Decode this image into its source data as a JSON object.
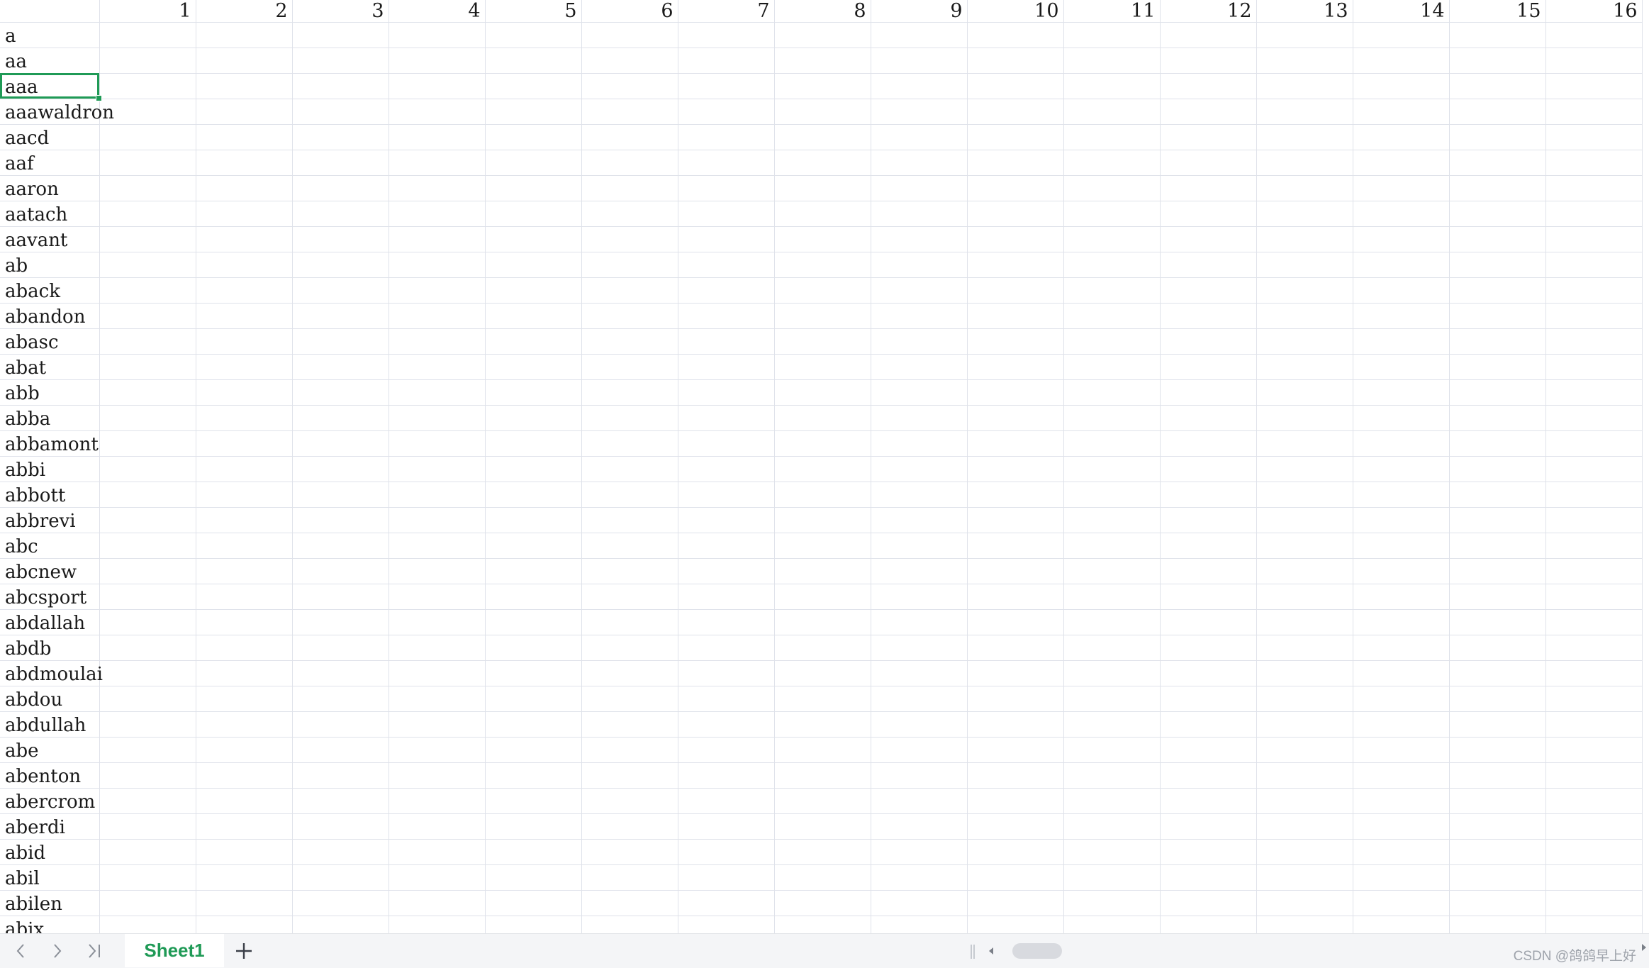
{
  "columns": [
    "1",
    "2",
    "3",
    "4",
    "5",
    "6",
    "7",
    "8",
    "9",
    "10",
    "11",
    "12",
    "13",
    "14",
    "15",
    "16"
  ],
  "rows": [
    "a",
    "aa",
    "aaa",
    "aaawaldron",
    "aacd",
    "aaf",
    "aaron",
    "aatach",
    "aavant",
    "ab",
    "aback",
    "abandon",
    "abasc",
    "abat",
    "abb",
    "abba",
    "abbamont",
    "abbi",
    "abbott",
    "abbrevi",
    "abc",
    "abcnew",
    "abcsport",
    "abdallah",
    "abdb",
    "abdmoulai",
    "abdou",
    "abdullah",
    "abe",
    "abenton",
    "abercrom",
    "aberdi",
    "abid",
    "abil",
    "abilen",
    "abix"
  ],
  "selected_row": 2,
  "sheet_tabs": [
    {
      "label": "Sheet1",
      "active": true
    }
  ],
  "watermark": "CSDN @鸽鸽早上好",
  "colors": {
    "accent": "#1f9a56",
    "grid": "#dfe2ea"
  },
  "icons": {
    "first": "chevron-left-icon",
    "prev": "chevron-right-icon",
    "last": "skip-last-icon",
    "add": "plus-icon"
  }
}
